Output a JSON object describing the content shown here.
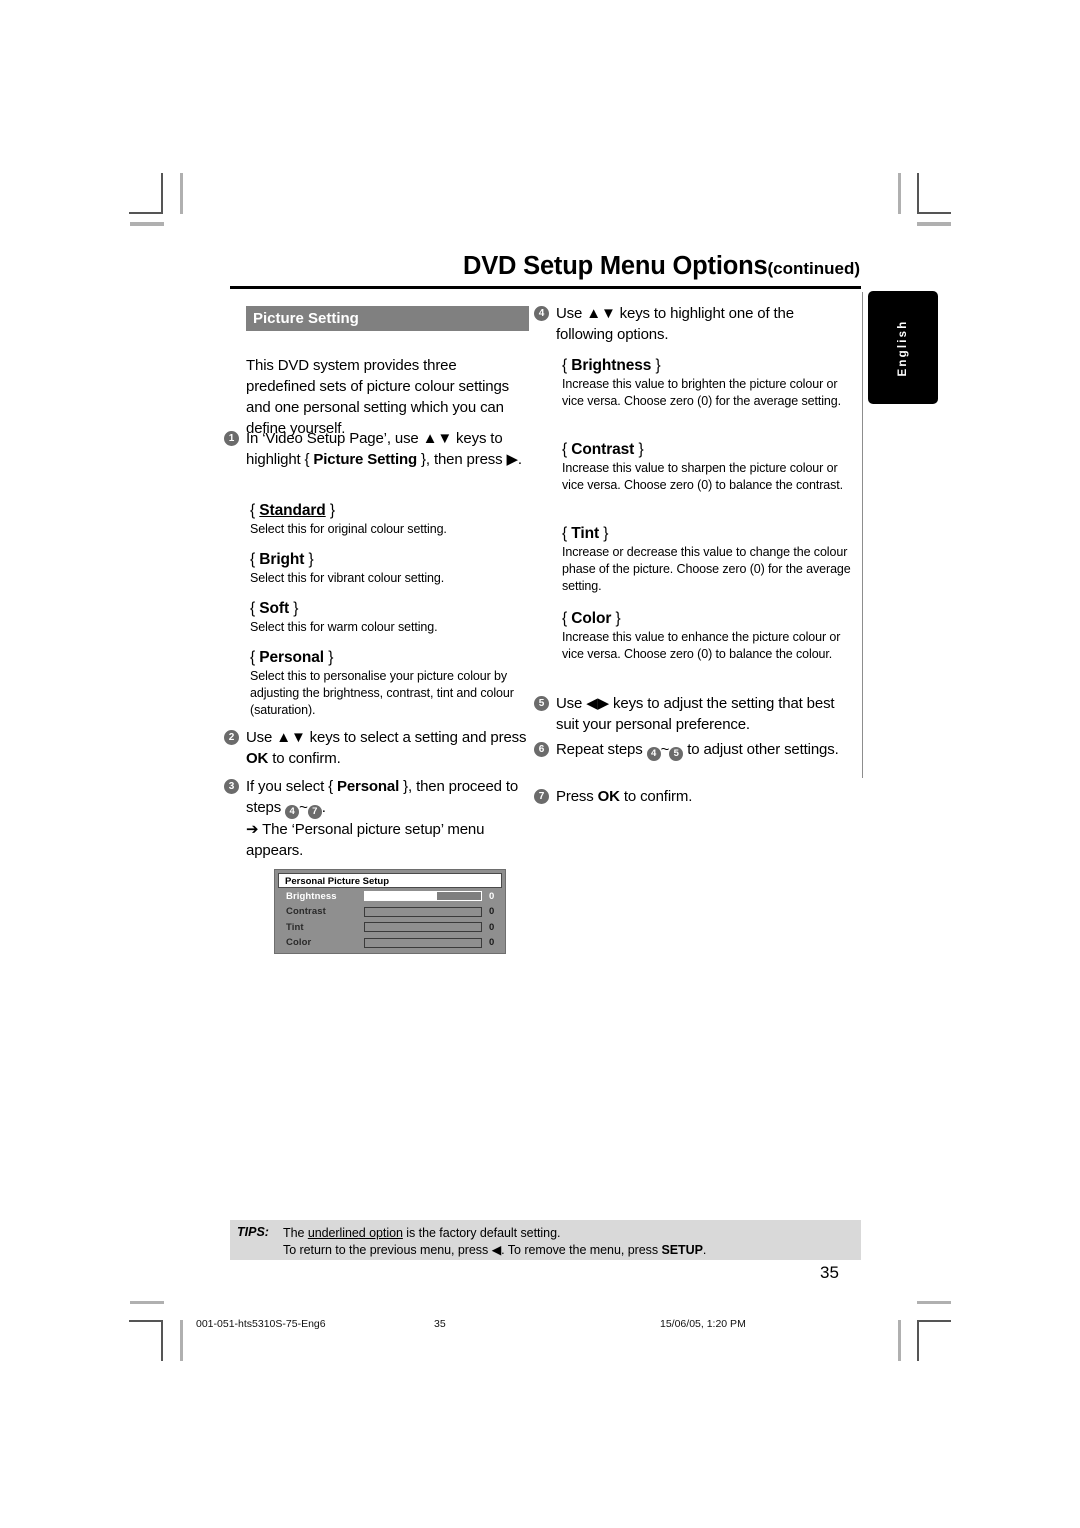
{
  "header": {
    "title": "DVD Setup Menu Options",
    "continued": "(continued)"
  },
  "side_tab": {
    "label": "English"
  },
  "section": {
    "title": "Picture Setting"
  },
  "left_column": {
    "intro": "This DVD system provides three predefined sets of picture colour settings and one personal setting which you can define yourself.",
    "step1": {
      "number": "1",
      "text_a": "In ‘Video Setup Page’, use ▲▼ keys to highlight { ",
      "text_bold": "Picture Setting",
      "text_b": " }, then press ▶."
    },
    "options": [
      {
        "name": "Standard",
        "underlined": true,
        "desc": "Select this for original colour setting."
      },
      {
        "name": "Bright",
        "underlined": false,
        "desc": "Select this for vibrant colour setting."
      },
      {
        "name": "Soft",
        "underlined": false,
        "desc": "Select this for warm colour setting."
      },
      {
        "name": "Personal",
        "underlined": false,
        "desc": "Select this to personalise your picture colour by adjusting the brightness, contrast, tint and colour (saturation)."
      }
    ],
    "step2": {
      "number": "2",
      "text_a": "Use ▲▼ keys to select a setting and press ",
      "text_bold": "OK",
      "text_b": " to confirm."
    },
    "step3": {
      "number": "3",
      "text_a": "If you select { ",
      "text_bold": "Personal",
      "text_b": " }, then proceed to steps ",
      "range_from": "4",
      "range_to": "7",
      "text_c": ".",
      "result": "➔ The ‘Personal picture setup’ menu appears."
    }
  },
  "osd_menu": {
    "title": "Personal Picture Setup",
    "rows": [
      {
        "label": "Brightness",
        "value": "0",
        "fill_percent": 62,
        "selected": true
      },
      {
        "label": "Contrast",
        "value": "0",
        "fill_percent": 0,
        "selected": false
      },
      {
        "label": "Tint",
        "value": "0",
        "fill_percent": 0,
        "selected": false
      },
      {
        "label": "Color",
        "value": "0",
        "fill_percent": 0,
        "selected": false
      }
    ]
  },
  "right_column": {
    "step4": {
      "number": "4",
      "text": "Use ▲▼ keys to highlight one of the following options."
    },
    "options": [
      {
        "name": "Brightness",
        "desc": "Increase this value to brighten the picture colour or vice versa. Choose zero (0) for the average setting."
      },
      {
        "name": "Contrast",
        "desc": "Increase this value to sharpen the picture colour or vice versa.  Choose zero (0) to balance the contrast."
      },
      {
        "name": "Tint",
        "desc": "Increase or decrease this value to change the colour phase of the picture.  Choose zero (0) for the average setting."
      },
      {
        "name": "Color",
        "desc": "Increase this value to enhance the picture colour or vice versa. Choose zero (0) to balance the colour."
      }
    ],
    "step5": {
      "number": "5",
      "text": "Use ◀▶  keys to adjust the setting that best suit your personal preference."
    },
    "step6": {
      "number": "6",
      "text_a": "Repeat steps ",
      "range_from": "4",
      "range_to": "5",
      "text_b": " to adjust other settings."
    },
    "step7": {
      "number": "7",
      "text_a": "Press ",
      "text_bold": "OK",
      "text_b": " to confirm."
    }
  },
  "tips": {
    "label": "TIPS:",
    "line1_a": "The ",
    "line1_u": "underlined option",
    "line1_b": " is the factory default setting.",
    "line2_a": "To return to the previous menu, press ◀. To remove the menu, press ",
    "line2_b": "SETUP",
    "line2_c": "."
  },
  "page_number": "35",
  "footer": {
    "file": "001-051-hts5310S-75-Eng6",
    "page": "35",
    "date": "15/06/05, 1:20 PM"
  }
}
